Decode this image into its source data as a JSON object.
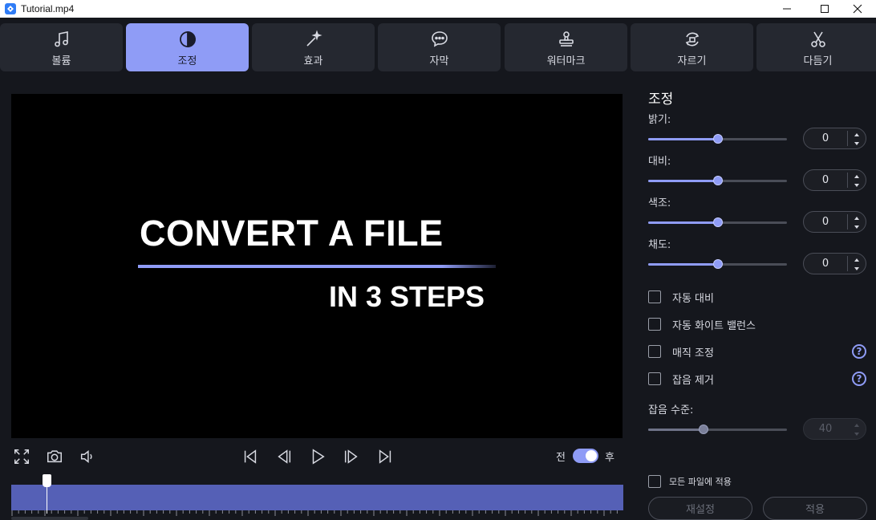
{
  "window": {
    "title": "Tutorial.mp4"
  },
  "tabs": [
    {
      "label": "볼륨",
      "icon": "music-note-icon",
      "active": false
    },
    {
      "label": "조정",
      "icon": "contrast-icon",
      "active": true
    },
    {
      "label": "효과",
      "icon": "magic-wand-icon",
      "active": false
    },
    {
      "label": "자막",
      "icon": "speech-bubble-icon",
      "active": false
    },
    {
      "label": "워터마크",
      "icon": "stamp-icon",
      "active": false
    },
    {
      "label": "자르기",
      "icon": "crop-rotate-icon",
      "active": false
    },
    {
      "label": "다듬기",
      "icon": "scissors-icon",
      "active": false
    }
  ],
  "preview": {
    "line1": "CONVERT A FILE",
    "line2": "IN 3 STEPS"
  },
  "playback": {
    "before_label": "전",
    "after_label": "후",
    "compare_enabled": true
  },
  "adjust": {
    "title": "조정",
    "sliders": [
      {
        "label": "밝기:",
        "value": "0",
        "level": 0.5
      },
      {
        "label": "대비:",
        "value": "0",
        "level": 0.5
      },
      {
        "label": "색조:",
        "value": "0",
        "level": 0.5
      },
      {
        "label": "채도:",
        "value": "0",
        "level": 0.5
      }
    ],
    "checks": [
      {
        "label": "자동 대비",
        "checked": false,
        "help": false
      },
      {
        "label": "자동 화이트 밸런스",
        "checked": false,
        "help": false
      },
      {
        "label": "매직 조정",
        "checked": false,
        "help": true
      },
      {
        "label": "잡음 제거",
        "checked": false,
        "help": true
      }
    ],
    "help_symbol": "?",
    "noise": {
      "label": "잡음 수준:",
      "value": "40",
      "level": 0.4,
      "disabled": true
    },
    "apply_all_label": "모든 파일에 적용",
    "reset_label": "재설정",
    "apply_label": "적용"
  },
  "colors": {
    "accent": "#8f9cf6",
    "background": "#15171d",
    "tab": "#252830",
    "timeline": "#5560b6"
  }
}
